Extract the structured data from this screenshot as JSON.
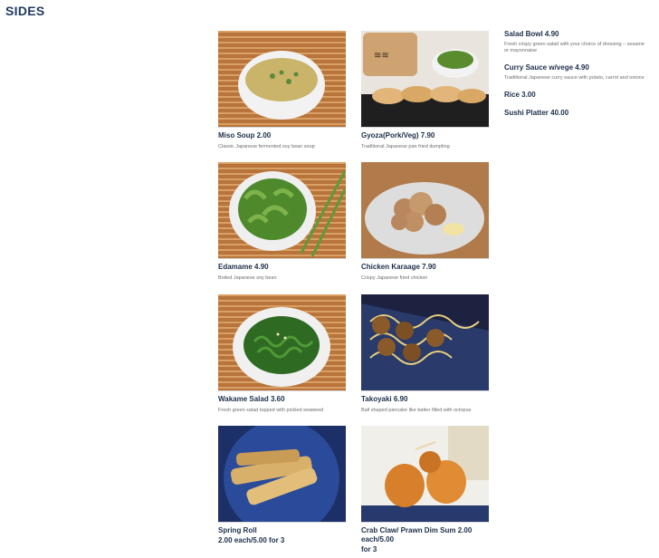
{
  "page": {
    "title": "SIDES"
  },
  "items": [
    {
      "name": "Miso Soup 2.00",
      "desc": "Classic Japanese fermented soy bean soup",
      "image": "miso-soup-photo"
    },
    {
      "name": "Gyoza(Pork/Veg) 7.90",
      "desc": "Traditional Japanese pan fried dumpling",
      "image": "gyoza-photo"
    },
    {
      "name": "Edamame 4.90",
      "desc": "Boiled Japanese soy bean",
      "image": "edamame-photo"
    },
    {
      "name": "Chicken Karaage 7.90",
      "desc": "Crispy Japanese fried chicken",
      "image": "chicken-karaage-photo"
    },
    {
      "name": "Wakame Salad 3.60",
      "desc": "Fresh green salad topped with pickled seaweed",
      "image": "wakame-salad-photo"
    },
    {
      "name": "Takoyaki 6.90",
      "desc": "Ball shaped pancake like batter filled with octopus",
      "image": "takoyaki-photo"
    },
    {
      "name": "Spring Roll",
      "name2": "2.00 each/5.00 for 3",
      "image": "spring-roll-photo"
    },
    {
      "name": "Crab Claw/ Prawn Dim Sum 2.00 each/5.00",
      "name2": "for 3",
      "image": "crab-claw-photo"
    }
  ],
  "side_list": [
    {
      "name": "Salad Bowl 4.90",
      "desc": "Fresh crispy green salad with your choice of dressing – sesame or mayonnaise"
    },
    {
      "name": "Curry Sauce w/vege 4.90",
      "desc": "Traditional Japanese curry sauce with potato, carrot and onions"
    },
    {
      "name": "Rice 3.00"
    },
    {
      "name": "Sushi Platter 40.00"
    }
  ],
  "colors": {
    "title": "#1f3a5f",
    "item_name": "#1c2e4a",
    "desc": "#6d6d6d"
  }
}
